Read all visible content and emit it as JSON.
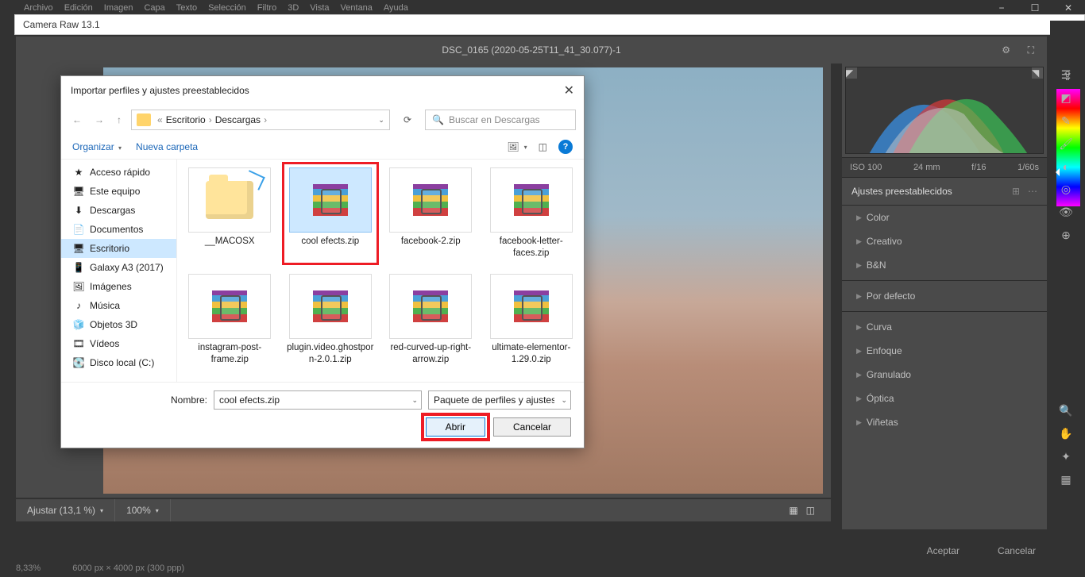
{
  "app": {
    "menus": [
      "Archivo",
      "Edición",
      "Imagen",
      "Capa",
      "Texto",
      "Selección",
      "Filtro",
      "3D",
      "Vista",
      "Ventana",
      "Ayuda"
    ],
    "cameraRawTitle": "Camera Raw 13.1",
    "documentTitle": "DSC_0165 (2020-05-25T11_41_30.077)-1"
  },
  "footer": {
    "adjustLabel": "Ajustar (13,1 %)",
    "zoomLabel": "100%",
    "accept": "Aceptar",
    "cancel": "Cancelar"
  },
  "status": {
    "pct": "8,33%",
    "dims": "6000 px × 4000 px (300 ppp)"
  },
  "histogram": {
    "iso": "ISO 100",
    "focal": "24 mm",
    "aperture": "f/16",
    "shutter": "1/60s"
  },
  "presetHeader": "Ajustes preestablecidos",
  "panel": {
    "groups1": [
      "Color",
      "Creativo",
      "B&N"
    ],
    "defaults": "Por defecto",
    "groups2": [
      "Curva",
      "Enfoque",
      "Granulado",
      "Óptica",
      "Viñetas"
    ]
  },
  "dialog": {
    "title": "Importar perfiles y ajustes preestablecidos",
    "breadcrumb": {
      "a": "Escritorio",
      "b": "Descargas"
    },
    "searchPlaceholder": "Buscar en Descargas",
    "organize": "Organizar",
    "newFolder": "Nueva carpeta",
    "side": [
      {
        "icon": "star",
        "label": "Acceso rápido"
      },
      {
        "icon": "pc",
        "label": "Este equipo"
      },
      {
        "icon": "down",
        "label": "Descargas"
      },
      {
        "icon": "doc",
        "label": "Documentos"
      },
      {
        "icon": "desk",
        "label": "Escritorio",
        "selected": true
      },
      {
        "icon": "phone",
        "label": "Galaxy A3 (2017)"
      },
      {
        "icon": "img",
        "label": "Imágenes"
      },
      {
        "icon": "music",
        "label": "Música"
      },
      {
        "icon": "cube",
        "label": "Objetos 3D"
      },
      {
        "icon": "vid",
        "label": "Vídeos"
      },
      {
        "icon": "disk",
        "label": "Disco local (C:)"
      }
    ],
    "files": [
      {
        "type": "folder",
        "label": "__MACOSX"
      },
      {
        "type": "rar",
        "label": "cool efects.zip",
        "selected": true,
        "highlight": true
      },
      {
        "type": "rar",
        "label": "facebook-2.zip"
      },
      {
        "type": "rar",
        "label": "facebook-letter-faces.zip"
      },
      {
        "type": "rar",
        "label": "instagram-post-frame.zip"
      },
      {
        "type": "rar",
        "label": "plugin.video.ghostporn-2.0.1.zip"
      },
      {
        "type": "rar",
        "label": "red-curved-up-right-arrow.zip"
      },
      {
        "type": "rar",
        "label": "ultimate-elementor-1.29.0.zip"
      }
    ],
    "nameLabel": "Nombre:",
    "nameValue": "cool efects.zip",
    "filterValue": "Paquete de perfiles y ajustes pre",
    "open": "Abrir",
    "cancel": "Cancelar"
  }
}
